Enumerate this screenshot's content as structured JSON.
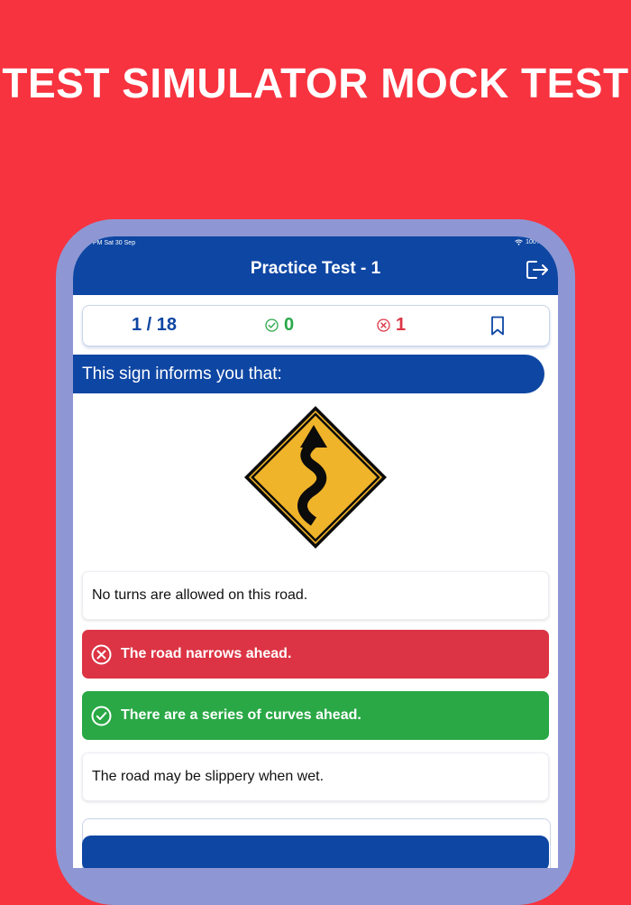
{
  "promo": {
    "title": "TEST SIMULATOR MOCK TEST"
  },
  "status_bar": {
    "time": "PM  Sat 30 Sep",
    "battery": "100%"
  },
  "navbar": {
    "title": "Practice Test - 1",
    "exit_icon": "exit-icon"
  },
  "counters": {
    "progress": "1 / 18",
    "correct_count": "0",
    "wrong_count": "1",
    "bookmark_icon": "bookmark-icon"
  },
  "question": {
    "text": "This sign informs you that:",
    "sign": "winding-road-sign"
  },
  "options": [
    {
      "text": "No turns are allowed on this road.",
      "state": "neutral"
    },
    {
      "text": "The road narrows ahead.",
      "state": "wrong"
    },
    {
      "text": "There are a series of curves ahead.",
      "state": "correct"
    },
    {
      "text": "The road may be slippery when wet.",
      "state": "neutral"
    }
  ],
  "colors": {
    "background": "#f7333f",
    "brand": "#0e46a3",
    "correct": "#29a845",
    "wrong": "#dc3444",
    "sign_yellow": "#f0b42a"
  }
}
